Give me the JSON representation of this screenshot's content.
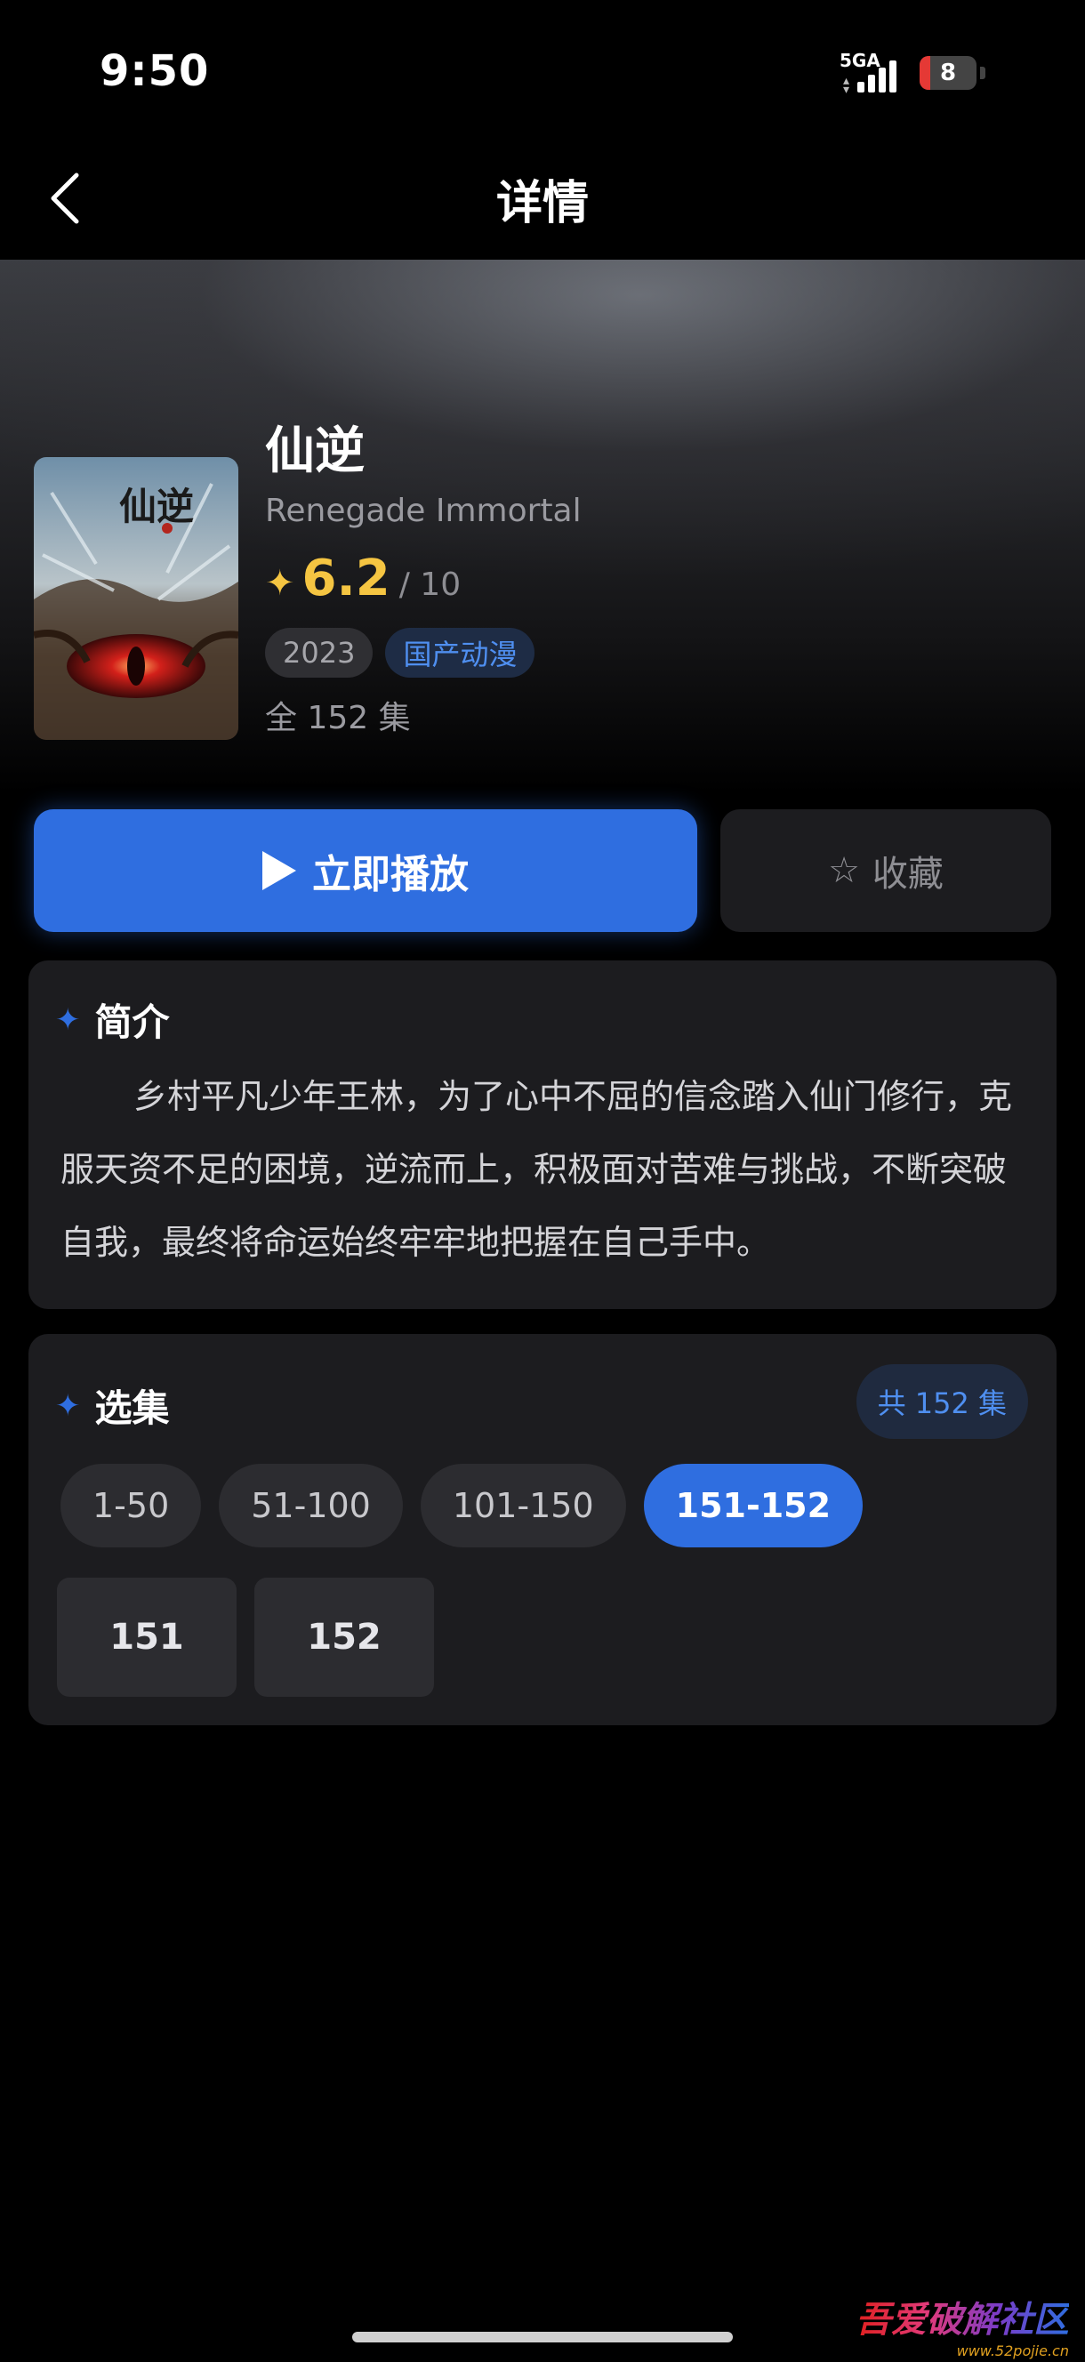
{
  "status_bar": {
    "time": "9:50",
    "network": "5GA",
    "battery_level": "8",
    "signal_icon": "signal-bars-icon",
    "battery_icon": "battery-icon"
  },
  "nav": {
    "title": "详情",
    "back_icon": "chevron-left-icon"
  },
  "show": {
    "title": "仙逆",
    "subtitle": "Renegade Immortal",
    "rating": "6.2",
    "rating_max": "/ 10",
    "rating_icon": "star-icon",
    "tags": [
      "2023",
      "国产动漫"
    ],
    "total_episodes": "全 152 集",
    "poster_title": "仙逆"
  },
  "actions": {
    "play_label": "立即播放",
    "play_icon": "play-icon",
    "favorite_label": "收藏",
    "favorite_icon": "star-outline-icon"
  },
  "intro": {
    "heading": "简介",
    "text": "乡村平凡少年王林，为了心中不屈的信念踏入仙门修行，克服天资不足的困境，逆流而上，积极面对苦难与挑战，不断突破自我，最终将命运始终牢牢地把握在自己手中。"
  },
  "episodes": {
    "heading": "选集",
    "count_badge": "共 152 集",
    "ranges": [
      "1-50",
      "51-100",
      "101-150",
      "151-152"
    ],
    "selected_range": "151-152",
    "items": [
      "151",
      "152"
    ]
  },
  "watermark": {
    "text": "吾爱破解社区",
    "url": "www.52pojie.cn"
  },
  "colors": {
    "accent": "#2f6ee0",
    "rating": "#f5c542",
    "card_bg": "#1c1c1f",
    "background": "#000000"
  }
}
